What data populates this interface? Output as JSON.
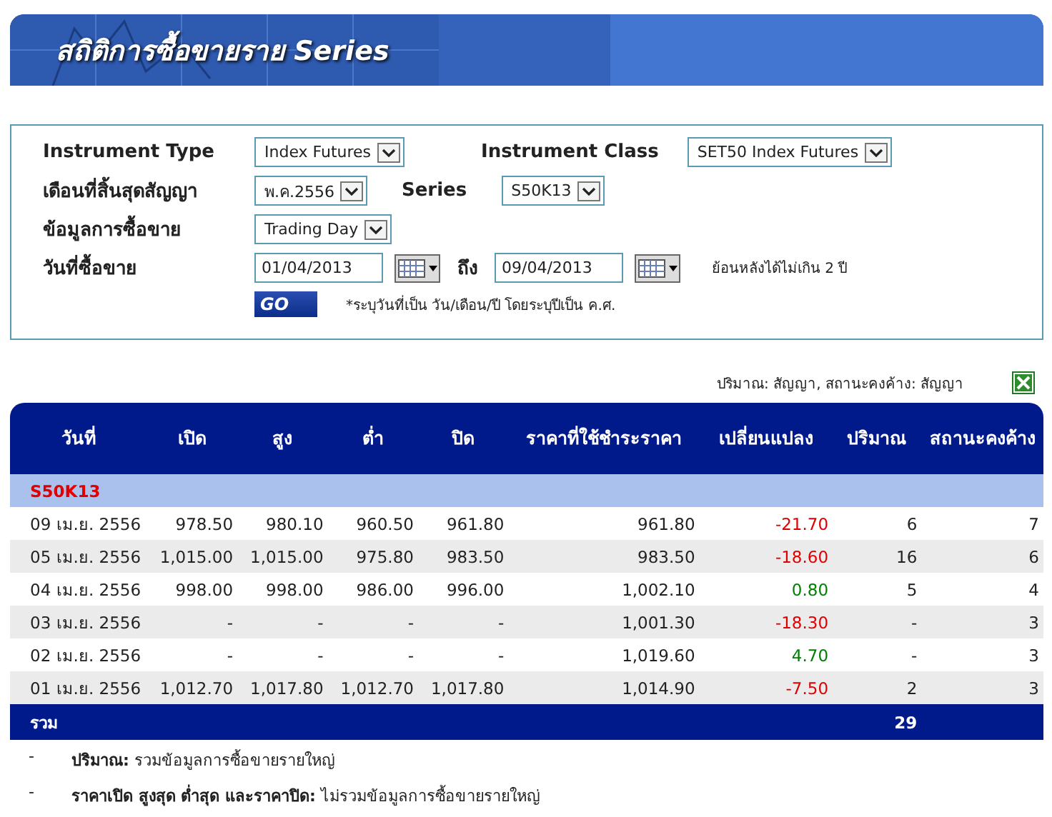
{
  "banner": {
    "title": "สถิติการซื้อขายราย Series"
  },
  "form": {
    "instrument_type": {
      "label": "Instrument Type",
      "value": "Index Futures"
    },
    "instrument_class": {
      "label": "Instrument Class",
      "value": "SET50 Index Futures"
    },
    "expiry_month": {
      "label": "เดือนที่สิ้นสุดสัญญา",
      "value": "พ.ค.2556"
    },
    "series": {
      "label": "Series",
      "value": "S50K13"
    },
    "trading_data": {
      "label": "ข้อมูลการซื้อขาย",
      "value": "Trading Day"
    },
    "trading_date": {
      "label": "วันที่ซื้อขาย",
      "from": "01/04/2013",
      "to_label": "ถึง",
      "to": "09/04/2013",
      "hint": "ย้อนหลังได้ไม่เกิน 2 ปี"
    },
    "go_button": "GO",
    "note": "*ระบุวันที่เป็น วัน/เดือน/ปี โดยระบุปีเป็น ค.ศ."
  },
  "units_note": "ปริมาณ: สัญญา, สถานะคงค้าง: สัญญา",
  "table": {
    "columns": [
      "วันที่",
      "เปิด",
      "สูง",
      "ต่ำ",
      "ปิด",
      "ราคาที่ใช้ชำระราคา",
      "เปลี่ยนแปลง",
      "ปริมาณ",
      "สถานะคงค้าง"
    ],
    "group": "S50K13",
    "rows": [
      {
        "cells": [
          "09 เม.ย. 2556",
          "978.50",
          "980.10",
          "960.50",
          "961.80",
          "961.80",
          "-21.70",
          "6",
          "7"
        ],
        "color": "#e00000"
      },
      {
        "cells": [
          "05 เม.ย. 2556",
          "1,015.00",
          "1,015.00",
          "975.80",
          "983.50",
          "983.50",
          "-18.60",
          "16",
          "6"
        ],
        "color": "#e00000"
      },
      {
        "cells": [
          "04 เม.ย. 2556",
          "998.00",
          "998.00",
          "986.00",
          "996.00",
          "1,002.10",
          "0.80",
          "5",
          "4"
        ],
        "color": "#008000"
      },
      {
        "cells": [
          "03 เม.ย. 2556",
          "-",
          "-",
          "-",
          "-",
          "1,001.30",
          "-18.30",
          "-",
          "3"
        ],
        "color": "#e00000"
      },
      {
        "cells": [
          "02 เม.ย. 2556",
          "-",
          "-",
          "-",
          "-",
          "1,019.60",
          "4.70",
          "-",
          "3"
        ],
        "color": "#008000"
      },
      {
        "cells": [
          "01 เม.ย. 2556",
          "1,012.70",
          "1,017.80",
          "1,012.70",
          "1,017.80",
          "1,014.90",
          "-7.50",
          "2",
          "3"
        ],
        "color": "#e00000"
      }
    ],
    "total": {
      "label": "รวม",
      "volume": "29"
    }
  },
  "footnotes": [
    {
      "bullet": "-",
      "term": "ปริมาณ:",
      "text": "รวมข้อมูลการซื้อขายรายใหญ่"
    },
    {
      "bullet": "-",
      "term": "ราคาเปิด สูงสุด ต่ำสุด และราคาปิด:",
      "text": "ไม่รวมข้อมูลการซื้อขายรายใหญ่"
    }
  ]
}
